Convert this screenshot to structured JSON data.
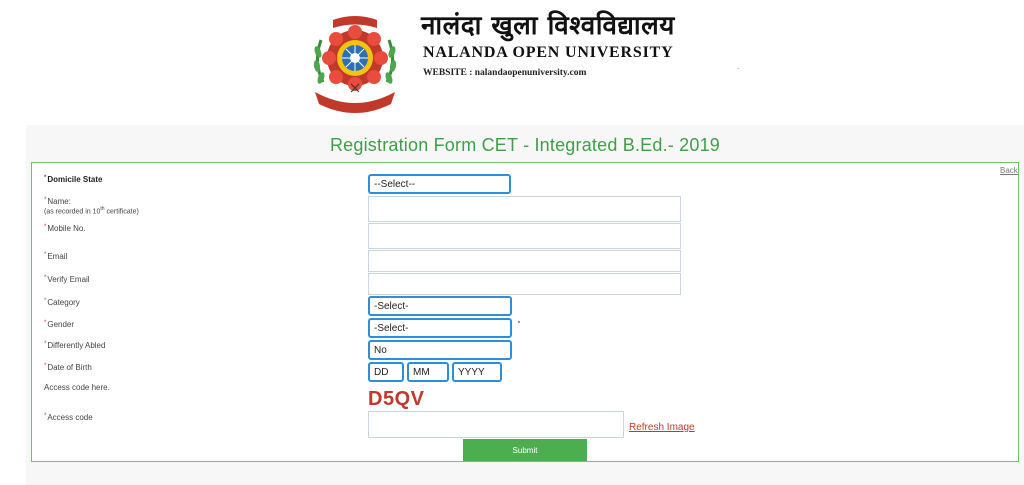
{
  "header": {
    "hindi_title": "नालंदा खुला विश्वविद्यालय",
    "english_title": "NALANDA OPEN UNIVERSITY",
    "website": "WEBSITE : nalandaopenuniversity.com",
    "separator_dot": "."
  },
  "form": {
    "title": "Registration Form CET - Integrated B.Ed.- 2019",
    "back_label": "Back",
    "required_mark": "*",
    "labels": {
      "domicile": "Domicile State",
      "name": "Name:",
      "name_note_pre": "(as recorded in 10",
      "name_note_sup": "th",
      "name_note_post": " certificate)",
      "mobile": "Mobile No.",
      "email": "Email",
      "verify_email": "Verify Email",
      "category": "Category",
      "gender": "Gender",
      "differently_abled": "Differently Abled",
      "dob": "Date of Birth",
      "access_code_here": "Access code here.",
      "access_code": "Access code"
    },
    "values": {
      "domicile": "--Select--",
      "category": "-Select-",
      "gender": "-Select-",
      "differently_abled": "No",
      "dob_day": "DD",
      "dob_month": "MM",
      "dob_year": "YYYY",
      "name": "",
      "mobile": "",
      "email": "",
      "verify_email": "",
      "access_code": ""
    },
    "captcha": "D5QV",
    "refresh_label": "Refresh Image",
    "submit_label": "Submit"
  },
  "colors": {
    "title_green": "#3f9f47",
    "submit_green": "#4cae4f",
    "select_border": "#2f8fd6",
    "captcha_red": "#c0392b"
  }
}
